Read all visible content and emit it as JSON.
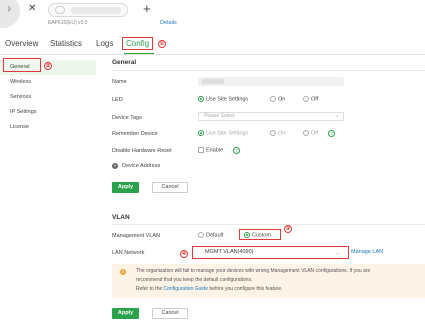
{
  "header": {
    "collapse_icon": "collapse-sidebar-icon",
    "close_icon": "close-icon",
    "model_text": "EAP610(EU) v3.0",
    "details_link": "Details",
    "add_icon": "plus-icon"
  },
  "tabs": [
    {
      "label": "Overview"
    },
    {
      "label": "Statistics"
    },
    {
      "label": "Logs"
    },
    {
      "label": "Config"
    }
  ],
  "badges": [
    "①",
    "②",
    "③",
    "④"
  ],
  "sidebar": {
    "items": [
      {
        "label": "General"
      },
      {
        "label": "Wireless"
      },
      {
        "label": "Services"
      },
      {
        "label": "IP Settings"
      },
      {
        "label": "License"
      }
    ]
  },
  "general": {
    "title": "General",
    "name_label": "Name",
    "led_label": "LED",
    "led_options": [
      "Use Site Settings",
      "On",
      "Off"
    ],
    "device_tags_label": "Device Tags",
    "device_tags_placeholder": "Please Select",
    "remember_label": "Remember Device",
    "remember_options": [
      "Use Site Settings",
      "On",
      "Off"
    ],
    "disable_reset_label": "Disable Hardware Reset",
    "enable_label": "Enable",
    "device_address_label": "Device Address",
    "apply_label": "Apply",
    "cancel_label": "Cancel"
  },
  "vlan": {
    "title": "VLAN",
    "mgmt_label": "Management VLAN",
    "mgmt_options": [
      "Default",
      "Custom"
    ],
    "lan_label": "LAN Network",
    "lan_value": "MGMT VLAN(4090)",
    "manage_lan": "Manage LAN",
    "warning_line1": "The organization will fail to manage your devices with wrong Management VLAN configurations. If you are",
    "warning_line2": "recommend that you keep the default configurations.",
    "warning_line3_pre": "Refer to the ",
    "warning_link": "Configuration Guide",
    "warning_line3_post": " before you configure this feature.",
    "apply_label": "Apply",
    "cancel_label": "Cancel"
  },
  "colors": {
    "accent": "#2aa14b",
    "annotation_red": "#e23a3a",
    "link": "#1a7ab8",
    "warning_bg": "#fdf3e7"
  }
}
